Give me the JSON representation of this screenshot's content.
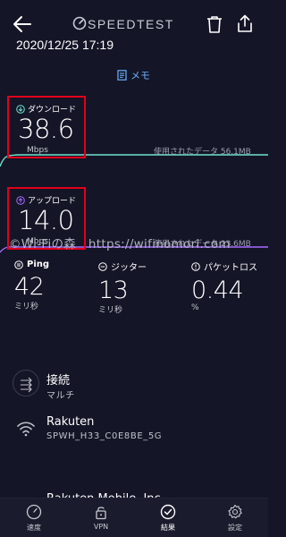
{
  "header": {
    "brand": "SPEEDTEST",
    "datetime": "2020/12/25 17:19",
    "memo_label": "メモ"
  },
  "download": {
    "label": "ダウンロード",
    "value": "38.6",
    "unit": "Mbps",
    "data_used": "使用されたデータ 56.1MB"
  },
  "upload": {
    "label": "アップロード",
    "value": "14.0",
    "unit": "Mbps",
    "data_used": "使用されたデータ 23.6MB"
  },
  "watermark": "©Wi-Fiの森　https://wifinomori.com",
  "stats": {
    "ping": {
      "label": "Ping",
      "value": "42",
      "unit": "ミリ秒"
    },
    "jitter": {
      "label": "ジッター",
      "value": "13",
      "unit": "ミリ秒"
    },
    "loss": {
      "label": "パケットロス",
      "value": "0.44",
      "unit": "%"
    }
  },
  "connection": {
    "title": "接続",
    "sub": "マルチ"
  },
  "network": {
    "title": "Rakuten",
    "sub": "SPWH_H33_C0E8BE_5G"
  },
  "provider": {
    "title": "Rakuten Mobile, Inc"
  },
  "nav": {
    "speed": "速度",
    "vpn": "VPN",
    "result": "結果",
    "settings": "設定"
  },
  "colors": {
    "background": "#141526",
    "highlight_border": "#e3001b",
    "download_line": "#6fe3cf",
    "upload_line": "#a56bff",
    "memo_accent": "#6bb2ff"
  }
}
